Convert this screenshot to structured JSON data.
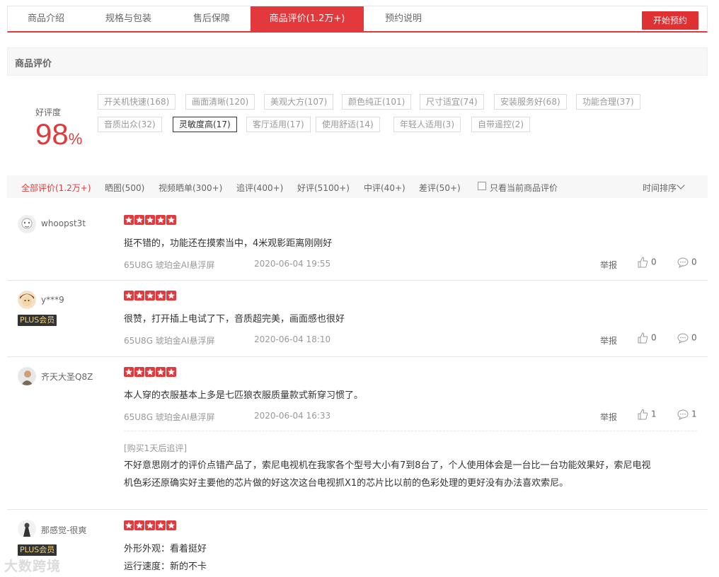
{
  "tabs": [
    {
      "label": "商品介绍"
    },
    {
      "label": "规格与包装"
    },
    {
      "label": "售后保障"
    },
    {
      "label": "商品评价(1.2万+)"
    },
    {
      "label": "预约说明"
    }
  ],
  "start_button": "开始预约",
  "section_title": "商品评价",
  "rating": {
    "label": "好评度",
    "value": "98",
    "unit": "%"
  },
  "tags": [
    {
      "label": "开关机快速(168)"
    },
    {
      "label": "画面清晰(120)"
    },
    {
      "label": "美观大方(107)"
    },
    {
      "label": "颜色纯正(101)"
    },
    {
      "label": "尺寸适宜(74)"
    },
    {
      "label": "安装服务好(68)"
    },
    {
      "label": "功能合理(37)"
    },
    {
      "label": "音质出众(32)"
    },
    {
      "label": "灵敏度高(17)"
    },
    {
      "label": "客厅适用(17)"
    },
    {
      "label": "使用舒适(14)"
    },
    {
      "label": "年轻人适用(3)"
    },
    {
      "label": "自带遥控(2)"
    }
  ],
  "filters": [
    {
      "label": "全部评价(1.2万+)"
    },
    {
      "label": "晒图(500)"
    },
    {
      "label": "视频晒单(300+)"
    },
    {
      "label": "追评(400+)"
    },
    {
      "label": "好评(5100+)"
    },
    {
      "label": "中评(40+)"
    },
    {
      "label": "差评(50+)"
    }
  ],
  "only_current_label": "只看当前商品评价",
  "sort_label": "时间排序",
  "plus_label": "PLUS会员",
  "report_label": "举报",
  "reviews": [
    {
      "user": "whoopst3t",
      "text": "挺不错的，功能还在摸索当中，4米观影距离刚刚好",
      "product": "65U8G 琥珀金AI悬浮屏",
      "date": "2020-06-04 19:55",
      "likes": "0",
      "comments": "0"
    },
    {
      "user": "y***9",
      "text": "很赞，打开插上电试了下，音质超完美，画面感也很好",
      "product": "65U8G 琥珀金AI悬浮屏",
      "date": "2020-06-04 18:10",
      "likes": "0",
      "comments": "0"
    },
    {
      "user": "齐天大圣Q8Z",
      "text": "本人穿的衣服基本上多是七匹狼衣服质量款式新穿习惯了。",
      "product": "65U8G 琥珀金AI悬浮屏",
      "date": "2020-06-04 16:33",
      "likes": "1",
      "comments": "1",
      "followup_tag": "[购买1天后追评]",
      "followup_line1": "不好意思刚才的评价点错产品了，索尼电视机在我家各个型号大小有7到8台了，个人使用体会是一台比一台功能效果好，索尼电视",
      "followup_line2": "机色彩还原确实好主要他的芯片做的好这次这台电视抓X1的芯片比以前的色彩处理的更好没有办法喜欢索尼。"
    },
    {
      "user": "那感觉-很爽",
      "line1": "外形外观：看着挺好",
      "line2": "运行速度：新的不卡"
    }
  ],
  "watermark": "大数跨境",
  "colors": {
    "accent": "#e4393c",
    "plus_bg": "#333333",
    "plus_text": "#f3d27a"
  }
}
